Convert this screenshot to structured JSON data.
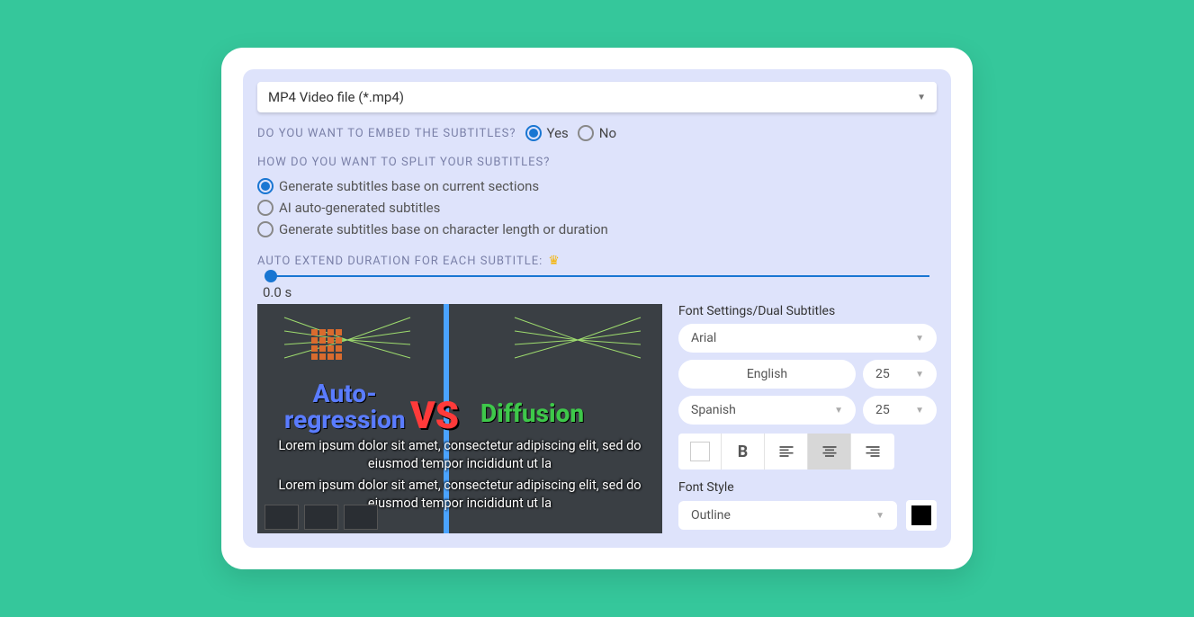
{
  "fileType": {
    "selected": "MP4 Video file (*.mp4)"
  },
  "embed": {
    "question": "DO YOU WANT TO EMBED THE SUBTITLES?",
    "yes": "Yes",
    "no": "No",
    "selected": "yes"
  },
  "split": {
    "question": "HOW DO YOU WANT TO SPLIT YOUR SUBTITLES?",
    "options": [
      "Generate subtitles base on current sections",
      "AI auto-generated subtitles",
      "Generate subtitles base on character length or duration"
    ],
    "selectedIndex": 0
  },
  "autoExtend": {
    "label": "AUTO EXTEND DURATION FOR EACH SUBTITLE:",
    "value": "0.0 s"
  },
  "preview": {
    "graphic": {
      "auto": "Auto-\nregression",
      "vs": "VS",
      "diffusion": "Diffusion"
    },
    "subtitle1": "Lorem ipsum dolor sit amet, consectetur adipiscing elit, sed do eiusmod tempor incididunt ut la",
    "subtitle2": "Lorem ipsum dolor sit amet, consectetur adipiscing elit, sed do eiusmod tempor incididunt ut la"
  },
  "fontSettings": {
    "title": "Font Settings/Dual Subtitles",
    "fontFamily": "Arial",
    "lang1": "English",
    "size1": "25",
    "lang2": "Spanish",
    "size2": "25",
    "textColor": "#ffffff",
    "bold": "B",
    "alignment": "center",
    "styleLabel": "Font Style",
    "style": "Outline",
    "styleColor": "#000000"
  }
}
